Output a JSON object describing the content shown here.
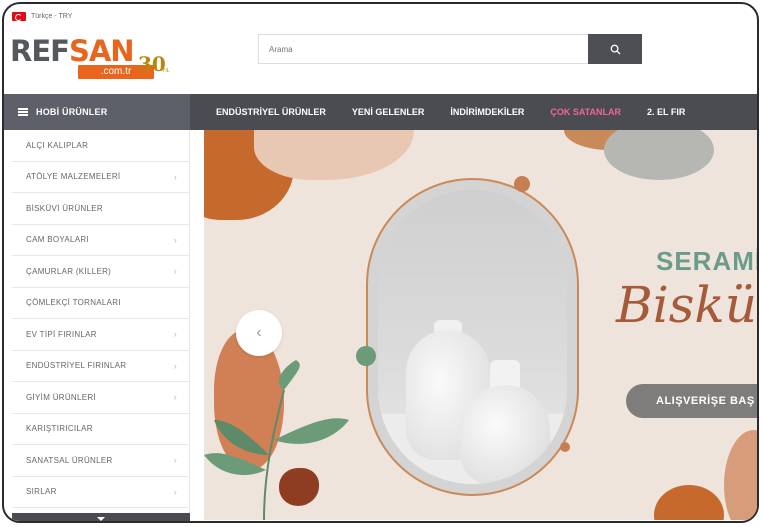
{
  "topbar": {
    "language": "Türkçe - TRY"
  },
  "logo": {
    "ref": "REF",
    "san": "SAN",
    "domain": ".com.tr",
    "years": "30",
    "years_sub": "YIL"
  },
  "search": {
    "placeholder": "Arama"
  },
  "nav": {
    "hobi": "HOBİ ÜRÜNLER",
    "items": [
      {
        "label": "ENDÜSTRİYEL ÜRÜNLER"
      },
      {
        "label": "YENİ GELENLER"
      },
      {
        "label": "İNDİRİMDEKİLER"
      },
      {
        "label": "ÇOK SATANLAR"
      },
      {
        "label": "2. EL FIR"
      }
    ]
  },
  "sidebar": {
    "items": [
      {
        "label": "ALÇI KALIPLAR"
      },
      {
        "label": "ATÖLYE MALZEMELERİ"
      },
      {
        "label": "BİSKÜVİ ÜRÜNLER"
      },
      {
        "label": "CAM BOYALARI"
      },
      {
        "label": "ÇAMURLAR (KİLLER)"
      },
      {
        "label": "ÇÖMLEKÇİ TORNALARI"
      },
      {
        "label": "EV TİPİ FIRINLAR"
      },
      {
        "label": "ENDÜSTRİYEL FIRINLAR"
      },
      {
        "label": "GİYİM ÜRÜNLERİ"
      },
      {
        "label": "KARIŞTIRICILAR"
      },
      {
        "label": "SANATSAL ÜRÜNLER"
      },
      {
        "label": "SIRLAR"
      }
    ]
  },
  "banner": {
    "title_line1": "SERAMİ",
    "title_line2": "Bisküvi",
    "cta": "ALIŞVERİŞE BAŞ",
    "prev_arrow": "‹"
  },
  "colors": {
    "accent": "#e8651e",
    "nav_bg": "#4a4c52",
    "hot": "#f0649a",
    "banner_bg": "#efe4db",
    "teal": "#6b9b8a",
    "terracotta": "#a65a3a"
  },
  "icons": {
    "search": "search-icon",
    "menu": "hamburger-icon",
    "chevron": "chevron-right-icon",
    "prev": "chevron-left-icon"
  }
}
